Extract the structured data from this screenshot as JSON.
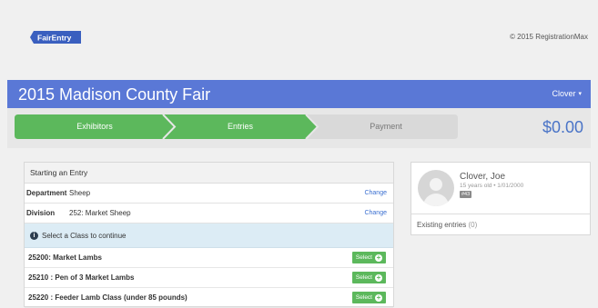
{
  "header": {
    "logo_text": "FairEntry",
    "copyright": "© 2015 RegistrationMax"
  },
  "navbar": {
    "title": "2015 Madison County Fair",
    "user": "Clover",
    "user_caret": "▾"
  },
  "steps": [
    {
      "label": "Exhibitors",
      "state": "complete"
    },
    {
      "label": "Entries",
      "state": "active"
    },
    {
      "label": "Payment",
      "state": "pending"
    }
  ],
  "total": "$0.00",
  "entry": {
    "heading": "Starting an Entry",
    "department_label": "Department",
    "department_value": "Sheep",
    "division_label": "Division",
    "division_value": "252: Market Sheep",
    "change_label": "Change",
    "notice": "Select a Class to continue",
    "select_label": "Select",
    "classes": [
      "25200: Market Lambs",
      "25210 : Pen of 3 Market Lambs",
      "25220 : Feeder Lamb Class (under 85 pounds)"
    ]
  },
  "exhibitor": {
    "name": "Clover, Joe",
    "detail": "15 years old • 1/01/2000",
    "badge": "#43",
    "existing_label": "Existing entries",
    "existing_count": "(0)"
  },
  "colors": {
    "navbar": "#5a78d6",
    "step_complete": "#5cb85c",
    "step_pending": "#d9d9d9",
    "total": "#4a74c7",
    "link": "#3a6fd1",
    "notice_bg": "#dcecf5"
  }
}
